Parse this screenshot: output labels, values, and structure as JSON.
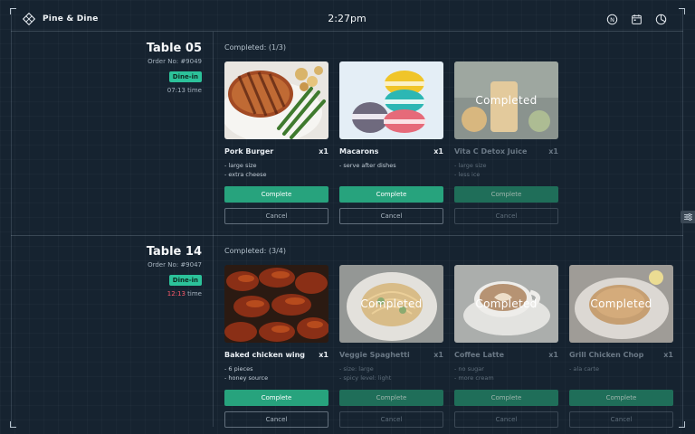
{
  "app": {
    "name": "Pine & Dine",
    "time": "2:27pm"
  },
  "icons": {
    "logo": "pine-dine-logo",
    "bell": "notification-icon",
    "calendar": "calendar-icon",
    "report": "pie-chart-icon",
    "handle": "sliders-icon"
  },
  "colors": {
    "accent": "#27a37d",
    "badge": "#2cc29a",
    "late": "#ff5b6a",
    "background": "#162330"
  },
  "tables": [
    {
      "title": "Table 05",
      "order_no": "Order No: #9049",
      "service": "Dine-in",
      "time": "07:13",
      "time_suffix": "time",
      "late": false,
      "completed_label": "Completed: (1/3)",
      "items": [
        {
          "name": "Pork Burger",
          "qty": "x1",
          "notes": [
            "- large size",
            "- extra cheese"
          ],
          "done": false,
          "image": "grilled-pork"
        },
        {
          "name": "Macarons",
          "qty": "x1",
          "notes": [
            "- serve after dishes"
          ],
          "done": false,
          "image": "macarons"
        },
        {
          "name": "Vita C Detox Juice",
          "qty": "x1",
          "notes": [
            "- large size",
            "- less ice"
          ],
          "done": true,
          "image": "juice"
        }
      ]
    },
    {
      "title": "Table 14",
      "order_no": "Order No: #9047",
      "service": "Dine-in",
      "time": "12:13",
      "time_suffix": "time",
      "late": true,
      "completed_label": "Completed: (3/4)",
      "items": [
        {
          "name": "Baked chicken wing",
          "qty": "x1",
          "notes": [
            "- 6 pieces",
            "- honey source"
          ],
          "done": false,
          "image": "chicken-wings"
        },
        {
          "name": "Veggie Spaghetti",
          "qty": "x1",
          "notes": [
            "- size: large",
            "- spicy level: light"
          ],
          "done": true,
          "image": "spaghetti"
        },
        {
          "name": "Coffee Latte",
          "qty": "x1",
          "notes": [
            "- no sugar",
            "- more cream"
          ],
          "done": true,
          "image": "latte"
        },
        {
          "name": "Grill Chicken Chop",
          "qty": "x1",
          "notes": [
            "- ala carte"
          ],
          "done": true,
          "image": "chicken-chop"
        }
      ]
    }
  ],
  "labels": {
    "complete": "Complete",
    "cancel": "Cancel",
    "completed_overlay": "Completed"
  }
}
